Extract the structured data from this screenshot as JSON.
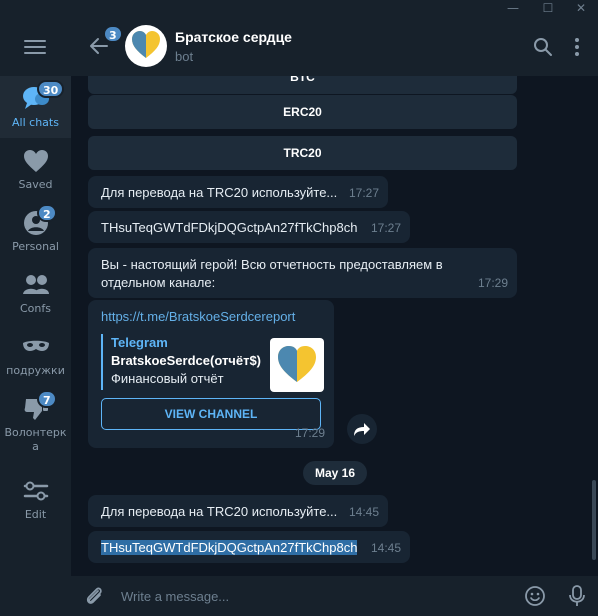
{
  "window": {
    "minimize_glyph": "—",
    "maximize_glyph": "☐",
    "close_glyph": "✕"
  },
  "sidebar": {
    "items": [
      {
        "label": "All chats",
        "icon": "chats-icon",
        "badge": "30",
        "active": true
      },
      {
        "label": "Saved",
        "icon": "heart-icon",
        "badge": ""
      },
      {
        "label": "Personal",
        "icon": "person-icon",
        "badge": "2"
      },
      {
        "label": "Confs",
        "icon": "group-icon",
        "badge": ""
      },
      {
        "label": "подружки",
        "icon": "mask-icon",
        "badge": ""
      },
      {
        "label": "Волонтерка",
        "icon": "thumbs-down-icon",
        "badge": "7"
      },
      {
        "label": "Edit",
        "icon": "sliders-icon",
        "badge": ""
      }
    ]
  },
  "header": {
    "back_badge": "3",
    "title": "Братское сердце",
    "subtitle": "bot"
  },
  "chat": {
    "keyboard_buttons": [
      "BTC",
      "ERC20",
      "TRC20"
    ],
    "messages": [
      {
        "text": "Для перевода на TRC20 используйте...",
        "time": "17:27"
      },
      {
        "text": "THsuTeqGWTdFDkjDQGctpAn27fTkChp8ch",
        "time": "17:27"
      },
      {
        "text_line1": "Вы - настоящий герой! Всю отчетность предоставляем в",
        "text_line2": "отдельном канале:",
        "time": "17:29"
      },
      {
        "link": "https://t.me/BratskoeSerdcereport",
        "preview_site": "Telegram",
        "preview_title": "BratskoeSerdce(отчёт$)",
        "preview_desc": "Финансовый отчёт",
        "button": "VIEW CHANNEL",
        "time": "17:29"
      },
      {
        "text": "Для перевода на TRC20 используйте...",
        "time": "14:45"
      },
      {
        "text": "THsuTeqGWTdFDkjDQGctpAn27fTkChp8ch",
        "time": "14:45",
        "selected": true
      }
    ],
    "date_separator": "May 16"
  },
  "composer": {
    "placeholder": "Write a message..."
  },
  "colors": {
    "accent": "#5eb5f7",
    "background": "#0e1621",
    "panel": "#17212b",
    "bubble": "#182533",
    "badge": "#4d8ac4"
  }
}
